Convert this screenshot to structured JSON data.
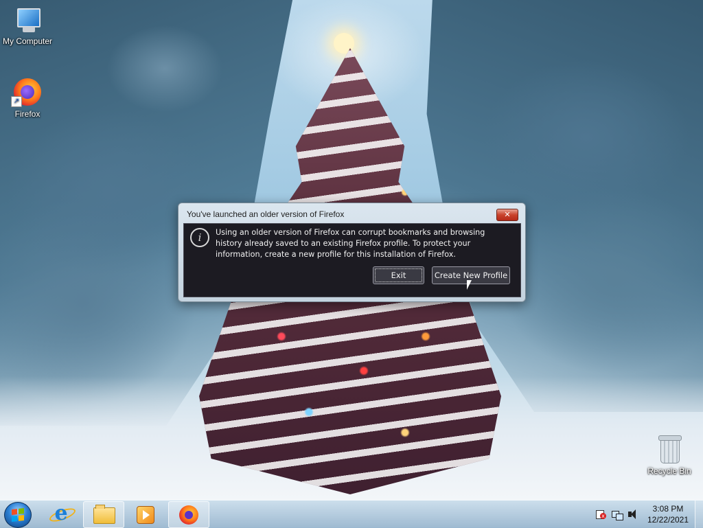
{
  "desktop": {
    "icons": [
      {
        "label": "My Computer",
        "icon": "computer-icon"
      },
      {
        "label": "Firefox",
        "icon": "firefox-icon"
      },
      {
        "label": "Recycle Bin",
        "icon": "recycle-bin-icon"
      }
    ]
  },
  "dialog": {
    "title": "You've launched an older version of Firefox",
    "close_label": "✕",
    "info_glyph": "i",
    "message": "Using an older version of Firefox can corrupt bookmarks and browsing history already saved to an existing Firefox profile. To protect your information, create a new profile for this installation of Firefox.",
    "buttons": {
      "exit": "Exit",
      "create": "Create New Profile"
    }
  },
  "taskbar": {
    "items": [
      {
        "name": "start",
        "icon": "windows-start-icon"
      },
      {
        "name": "internet-explorer",
        "icon": "internet-explorer-icon"
      },
      {
        "name": "windows-explorer",
        "icon": "folder-icon"
      },
      {
        "name": "media-player",
        "icon": "media-player-icon"
      },
      {
        "name": "firefox",
        "icon": "firefox-icon"
      }
    ],
    "clock": {
      "time": "3:08 PM",
      "date": "12/22/2021"
    }
  },
  "colors": {
    "dialog_content_bg": "#1c1b22",
    "close_button": "#c9432c",
    "taskbar": "#a8c4da"
  }
}
